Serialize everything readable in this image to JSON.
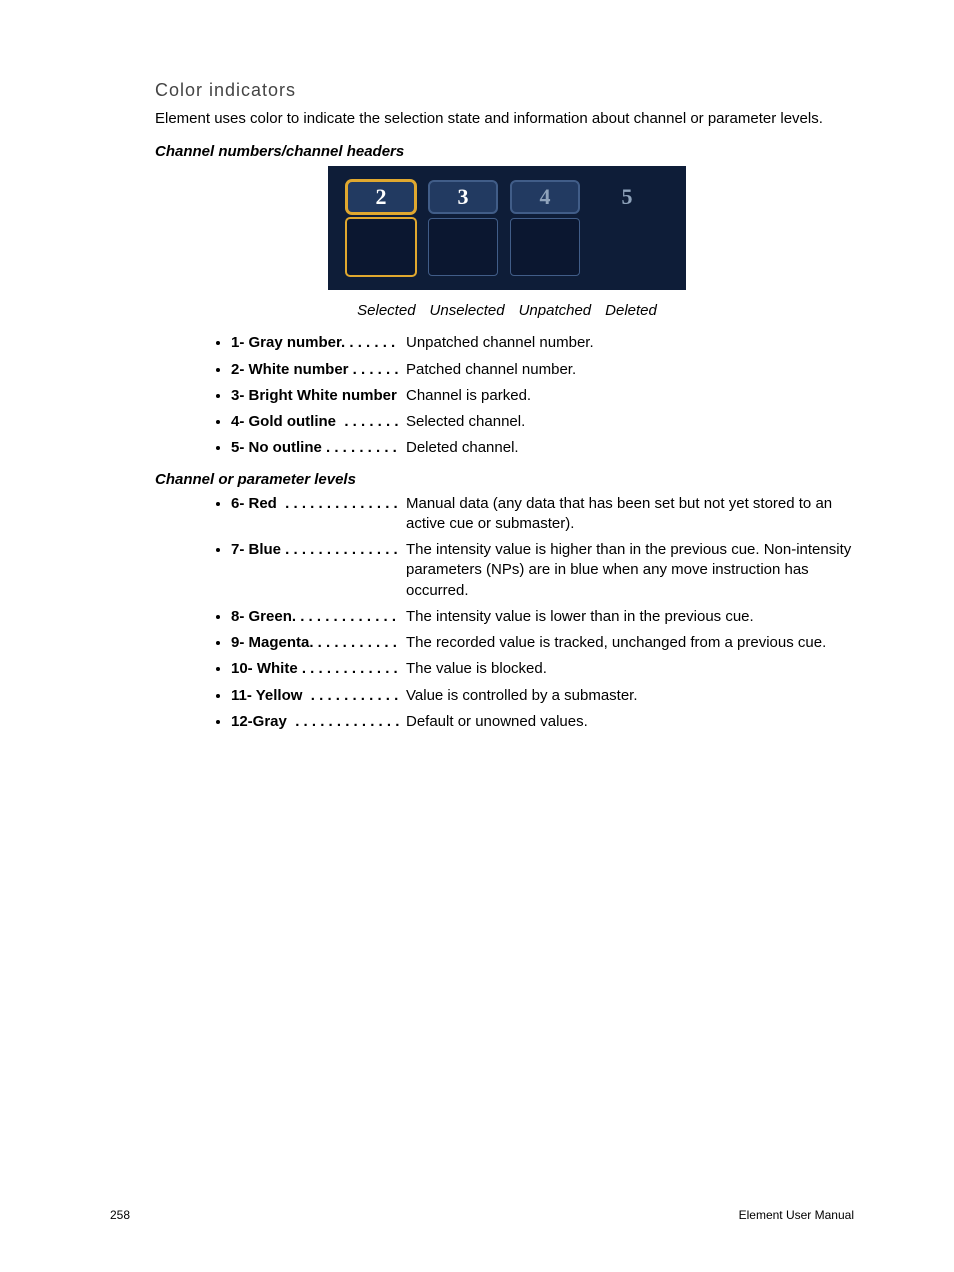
{
  "section_title": "Color indicators",
  "intro": "Element uses color to indicate the selection state and information about channel or parameter levels.",
  "sub1": "Channel numbers/channel headers",
  "channels": [
    {
      "num": "2",
      "cls": "selected"
    },
    {
      "num": "3",
      "cls": ""
    },
    {
      "num": "4",
      "cls": "unpatched"
    },
    {
      "num": "5",
      "cls": "deleted"
    }
  ],
  "state_labels": [
    "Selected",
    "Unselected",
    "Unpatched",
    "Deleted"
  ],
  "list1": [
    {
      "term": "1- Gray number",
      "dots": ". . . . . . .",
      "desc": "Unpatched channel number."
    },
    {
      "term": "2- White number",
      "dots": " . . . . . .",
      "desc": "Patched channel number."
    },
    {
      "term": "3- Bright White number",
      "dots": "",
      "desc": "Channel is parked."
    },
    {
      "term": "4- Gold outline ",
      "dots": " . . . . . . .",
      "desc": "Selected channel."
    },
    {
      "term": "5- No outline",
      "dots": " . . . . . . . . .",
      "desc": "Deleted channel."
    }
  ],
  "sub2": "Channel or parameter levels",
  "list2": [
    {
      "term": "6- Red ",
      "dots": " . . . . . . . . . . . . . .",
      "desc": "Manual data (any data that has been set but not yet stored to an active cue or submaster)."
    },
    {
      "term": "7- Blue",
      "dots": " . . . . . . . . . . . . . .",
      "desc": "The intensity value is higher than in the previous cue. Non-intensity parameters (NPs) are in blue when any move instruction has occurred."
    },
    {
      "term": "8- Green",
      "dots": ". . . . . . . . . . . . .",
      "desc": "The intensity value is lower than in the previous cue."
    },
    {
      "term": "9- Magenta",
      "dots": ". . . . . . . . . . .",
      "desc": "The recorded value is tracked, unchanged from a previous cue."
    },
    {
      "term": "10- White",
      "dots": " . . . . . . . . . . . .",
      "desc": "The value is blocked."
    },
    {
      "term": "11- Yellow ",
      "dots": " . . . . . . . . . . .",
      "desc": "Value is controlled by a submaster."
    },
    {
      "term": "12-Gray ",
      "dots": " . . . . . . . . . . . . .",
      "desc": "Default or unowned values."
    }
  ],
  "page_num": "258",
  "doc_title": "Element User Manual"
}
